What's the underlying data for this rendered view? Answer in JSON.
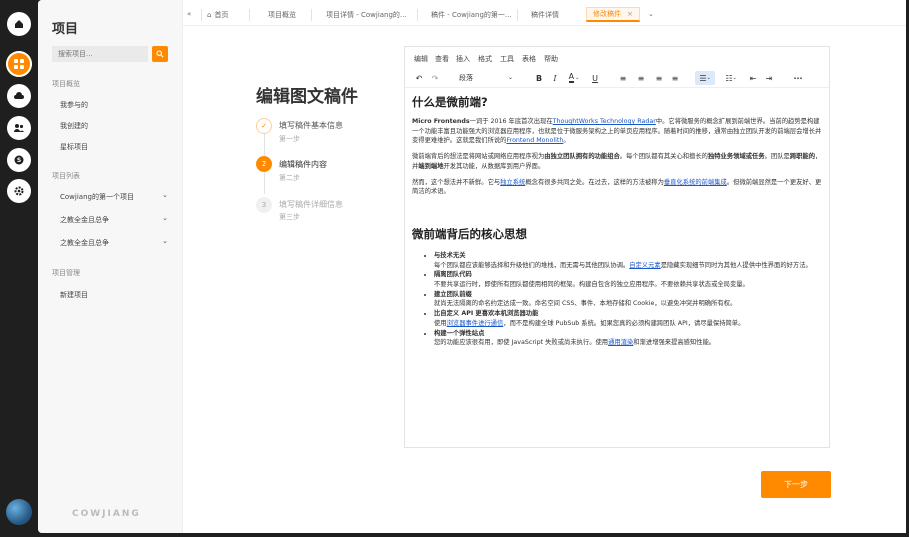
{
  "colors": {
    "accent": "#ff8a00",
    "rail": "#1f1f1f",
    "link": "#1a57c9"
  },
  "rail": {
    "icons": [
      "home-icon",
      "grid-icon",
      "cloud-icon",
      "users-icon",
      "skype-icon",
      "gear-icon"
    ]
  },
  "sidebar": {
    "title": "项目",
    "search_placeholder": "搜索项目...",
    "sections": {
      "overview": "项目概览",
      "list": "项目列表",
      "manage": "项目管理"
    },
    "overview_items": [
      "我参与的",
      "我创建的",
      "星标项目"
    ],
    "list_items": [
      "Cowjiang的第一个项目",
      "之教全金且总争",
      "之教全金且总争"
    ],
    "manage_items": [
      "新建项目"
    ],
    "logo": "COWJIANG"
  },
  "tabs": {
    "items": [
      "首页",
      "项目概览",
      "项目详情 - Cowjiang的...",
      "稿件 - Cowjiang的第一...",
      "稿件详情",
      "修改稿件"
    ],
    "active_index": 5
  },
  "steps": {
    "title": "编辑图文稿件",
    "items": [
      {
        "label": "填写稿件基本信息",
        "sub": "第一步",
        "state": "done",
        "num": "✓"
      },
      {
        "label": "编辑稿件内容",
        "sub": "第二步",
        "state": "current",
        "num": "2"
      },
      {
        "label": "填写稿件详细信息",
        "sub": "第三步",
        "state": "todo",
        "num": "3"
      }
    ]
  },
  "editor": {
    "menu": [
      "编辑",
      "查看",
      "插入",
      "格式",
      "工具",
      "表格",
      "帮助"
    ],
    "block_format": "段落",
    "content": {
      "h1": "什么是微前端?",
      "p1_pre_bold": "Micro Frontends",
      "p1_a": "一词于 2016 年底首次出现在",
      "p1_link1": "ThoughtWorks Technology Radar",
      "p1_b": "中。它将微服务的概念扩展到前端世界。当前的趋势是构建一个功能丰富且功能强大的浏览器应用程序，也就是位于微服务架构之上的单页应用程序。随着时间的推移，通常由独立团队开发的前端层会增长并变得更难维护。这就是我们所说的",
      "p1_link2": "Frontend Monolith",
      "p1_c": "。",
      "p2_a": "微前端背后的想法是将网站或网络应用程序视为",
      "p2_bold1": "由独立团队拥有的功能组合",
      "p2_b": "。每个团队都有其关心和擅长的",
      "p2_bold2": "独特业务领域或任务",
      "p2_c": "。团队是",
      "p2_bold3": "跨职能的",
      "p2_d": "，并",
      "p2_bold4": "端到端地",
      "p2_e": "开发其功能，从数据库到用户界面。",
      "p3_a": "然而，这个想法并不新鲜。它与",
      "p3_link1": "独立系统",
      "p3_b": "概念有很多共同之处。在过去，这样的方法被称为",
      "p3_link2": "垂直化系统的前端集成",
      "p3_c": "。但微前端显然是一个更友好、更简洁的术语。",
      "h2": "微前端背后的核心思想",
      "bullets": [
        {
          "title": "与技术无关",
          "desc_a": "每个团队都应该能够选择和升级他们的堆栈，而无需与其他团队协调。",
          "link": "自定义元素",
          "desc_b": "是隐藏实现细节同时为其他人提供中性界面的好方法。"
        },
        {
          "title": "隔离团队代码",
          "desc_a": "不要共享运行时，即使所有团队都使用相同的框架。构建自包含的独立应用程序。不要依赖共享状态或全局变量。",
          "link": "",
          "desc_b": ""
        },
        {
          "title": "建立团队前缀",
          "desc_a": "就尚无法隔离的命名约定达成一致。命名空间 CSS、事件、本地存储和 Cookie，以避免冲突并明确所有权。",
          "link": "",
          "desc_b": ""
        },
        {
          "title": "比自定义 API 更喜欢本机浏览器功能",
          "desc_a": "使用",
          "link": "浏览器事件进行通信",
          "desc_b": "，而不是构建全球 PubSub 系统。如果您真的必须构建跨团队 API，请尽量保持简单。"
        },
        {
          "title": "构建一个弹性站点",
          "desc_a": "您的功能应该很有用，即使 JavaScript 失败或尚未执行。使用",
          "link": "通用渲染",
          "desc_b": "和渐进增强来提高感知性能。"
        }
      ]
    }
  },
  "next_button": "下一步"
}
